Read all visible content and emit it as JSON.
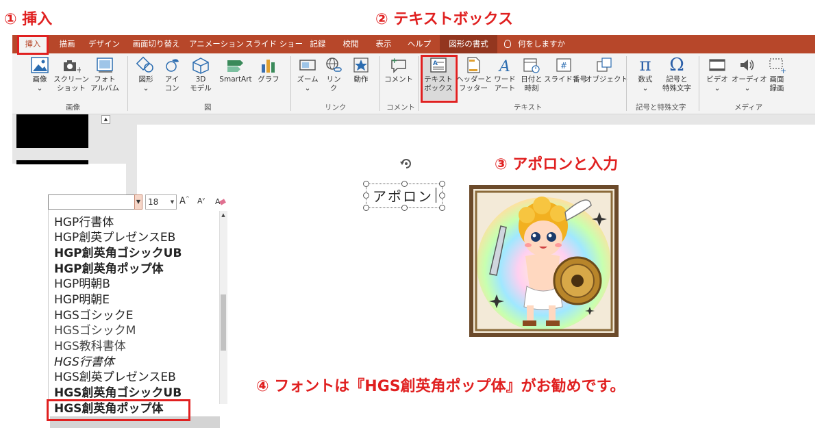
{
  "annotations": {
    "step1": "① 挿入",
    "step2": "② テキストボックス",
    "step3": "③ アポロンと入力",
    "step4": "④ フォントは『HGS創英角ポップ体』がお勧めです。"
  },
  "colors": {
    "ribbon_tab_bg": "#b7472a",
    "annotation_red": "#e02020",
    "ribbon_body_bg": "#f3f3f3"
  },
  "tabs": [
    "挿入",
    "描画",
    "デザイン",
    "画面切り替え",
    "アニメーション",
    "スライド ショー",
    "記録",
    "校閲",
    "表示",
    "ヘルプ",
    "図形の書式"
  ],
  "tell_me": "何をしますか",
  "ribbon": {
    "images_btn": "画像",
    "screenshot_btn_1": "スクリーン",
    "screenshot_btn_2": "ショット",
    "album_btn_1": "フォト",
    "album_btn_2": "アルバム",
    "group_images": "画像",
    "shapes_btn": "図形",
    "icons_btn_1": "アイ",
    "icons_btn_2": "コン",
    "model3d_btn_1": "3D",
    "model3d_btn_2": "モデル",
    "smartart_btn": "SmartArt",
    "graph_btn": "グラフ",
    "group_illust": "図",
    "zoom_btn": "ズーム",
    "link_btn_1": "リン",
    "link_btn_2": "ク",
    "action_btn": "動作",
    "group_link": "リンク",
    "comment_btn": "コメント",
    "group_comment": "コメント",
    "textbox_btn_1": "テキスト",
    "textbox_btn_2": "ボックス",
    "header_btn_1": "ヘッダーと",
    "header_btn_2": "フッター",
    "wordart_btn_1": "ワード",
    "wordart_btn_2": "アート",
    "datetime_btn_1": "日付と",
    "datetime_btn_2": "時刻",
    "slidenum_btn": "スライド番号",
    "object_btn": "オブジェクト",
    "group_text": "テキスト",
    "equation_btn": "数式",
    "symbol_btn_1": "記号と",
    "symbol_btn_2": "特殊文字",
    "group_symbols": "記号と特殊文字",
    "video_btn": "ビデオ",
    "audio_btn": "オーディオ",
    "screenrec_btn_1": "画面",
    "screenrec_btn_2": "録画",
    "group_media": "メディア"
  },
  "textbox_value": "アポロン",
  "font_panel": {
    "font_input_value": "",
    "size_value": "18",
    "grow_label": "A",
    "shrink_label": "A",
    "fonts": [
      "HGP行書体",
      "HGP創英プレゼンスEB",
      "HGP創英角ゴシックUB",
      "HGP創英角ポップ体",
      "HGP明朝B",
      "HGP明朝E",
      "HGSゴシックE",
      "HGSゴシックM",
      "HGS教科書体",
      "HGS行書体",
      "HGS創英プレゼンスEB",
      "HGS創英角ゴシックUB",
      "HGS創英角ポップ体"
    ],
    "selected_font": "HGS創英角ポップ体"
  }
}
